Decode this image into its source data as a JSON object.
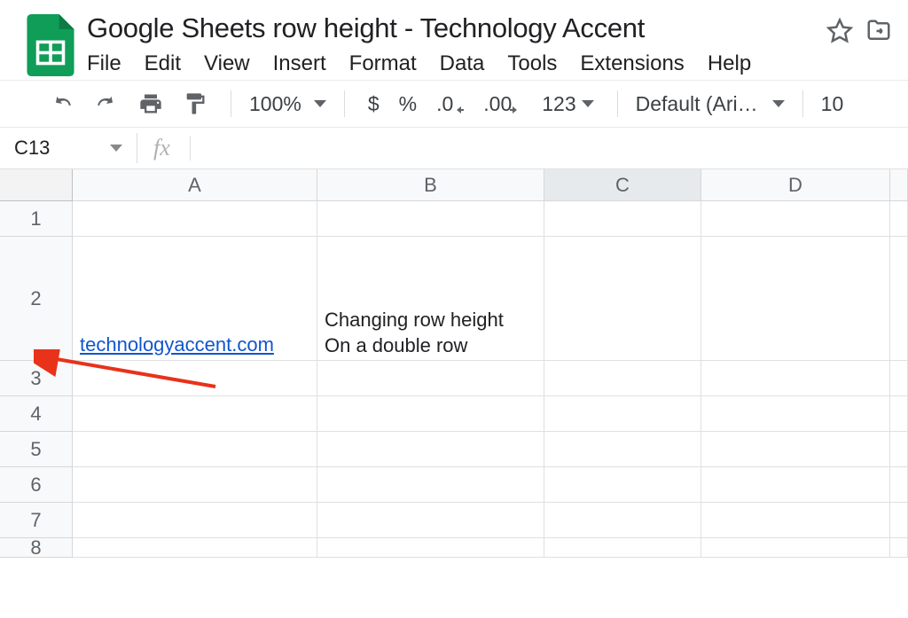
{
  "doc_title": "Google Sheets row height - Technology Accent",
  "menu": {
    "file": "File",
    "edit": "Edit",
    "view": "View",
    "insert": "Insert",
    "format": "Format",
    "data": "Data",
    "tools": "Tools",
    "extensions": "Extensions",
    "help": "Help"
  },
  "toolbar": {
    "zoom": "100%",
    "currency": "$",
    "percent": "%",
    "dec_less": ".0",
    "dec_more": ".00",
    "num_fmt": "123",
    "font": "Default (Ari…",
    "font_size": "10"
  },
  "name_box": "C13",
  "fx_label": "fx",
  "columns": {
    "a": "A",
    "b": "B",
    "c": "C",
    "d": "D"
  },
  "rows": {
    "r1": "1",
    "r2": "2",
    "r3": "3",
    "r4": "4",
    "r5": "5",
    "r6": "6",
    "r7": "7",
    "r8": "8"
  },
  "cells": {
    "a2": "technologyaccent.com",
    "b2": "Changing row height\nOn a double row"
  }
}
